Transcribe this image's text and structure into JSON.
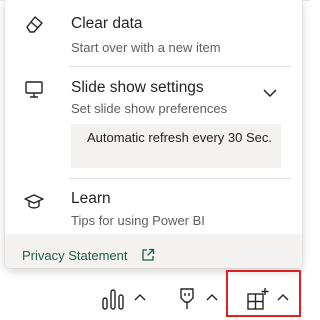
{
  "menu": {
    "clear_data": {
      "title": "Clear data",
      "description": "Start over with a new item",
      "icon": "eraser-icon"
    },
    "slide_show": {
      "title": "Slide show settings",
      "description": "Set slide show preferences",
      "icon": "monitor-icon",
      "refresh_option": "Automatic refresh every 30 Sec."
    },
    "learn": {
      "title": "Learn",
      "description": "Tips for using Power BI",
      "icon": "graduation-cap-icon"
    }
  },
  "footer": {
    "privacy_link": "Privacy Statement",
    "link_color": "#1f5e4a"
  },
  "toolbar": {
    "buttons": [
      "chart-icon",
      "plug-icon",
      "add-widget-icon"
    ],
    "highlight_color": "#e02020"
  }
}
